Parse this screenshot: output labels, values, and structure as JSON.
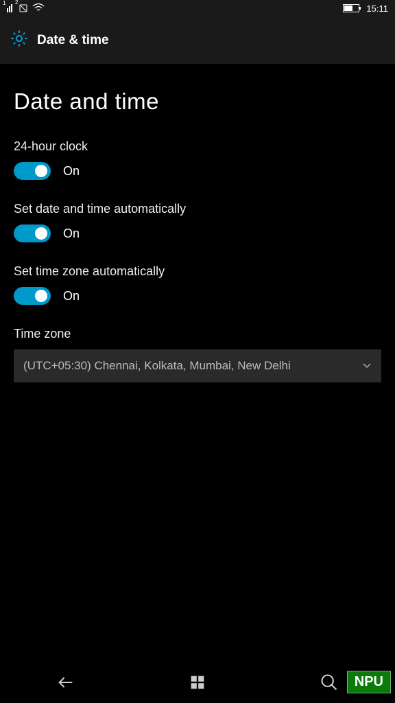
{
  "status": {
    "time": "15:11",
    "sim1": "1",
    "sim2": "2"
  },
  "header": {
    "title": "Date & time"
  },
  "page": {
    "title": "Date and time"
  },
  "settings": {
    "clock24": {
      "label": "24-hour clock",
      "state": "On"
    },
    "autoDateTime": {
      "label": "Set date and time automatically",
      "state": "On"
    },
    "autoTimezone": {
      "label": "Set time zone automatically",
      "state": "On"
    },
    "timezone": {
      "label": "Time zone",
      "value": "(UTC+05:30) Chennai, Kolkata, Mumbai, New Delhi"
    }
  },
  "watermark": "NPU"
}
